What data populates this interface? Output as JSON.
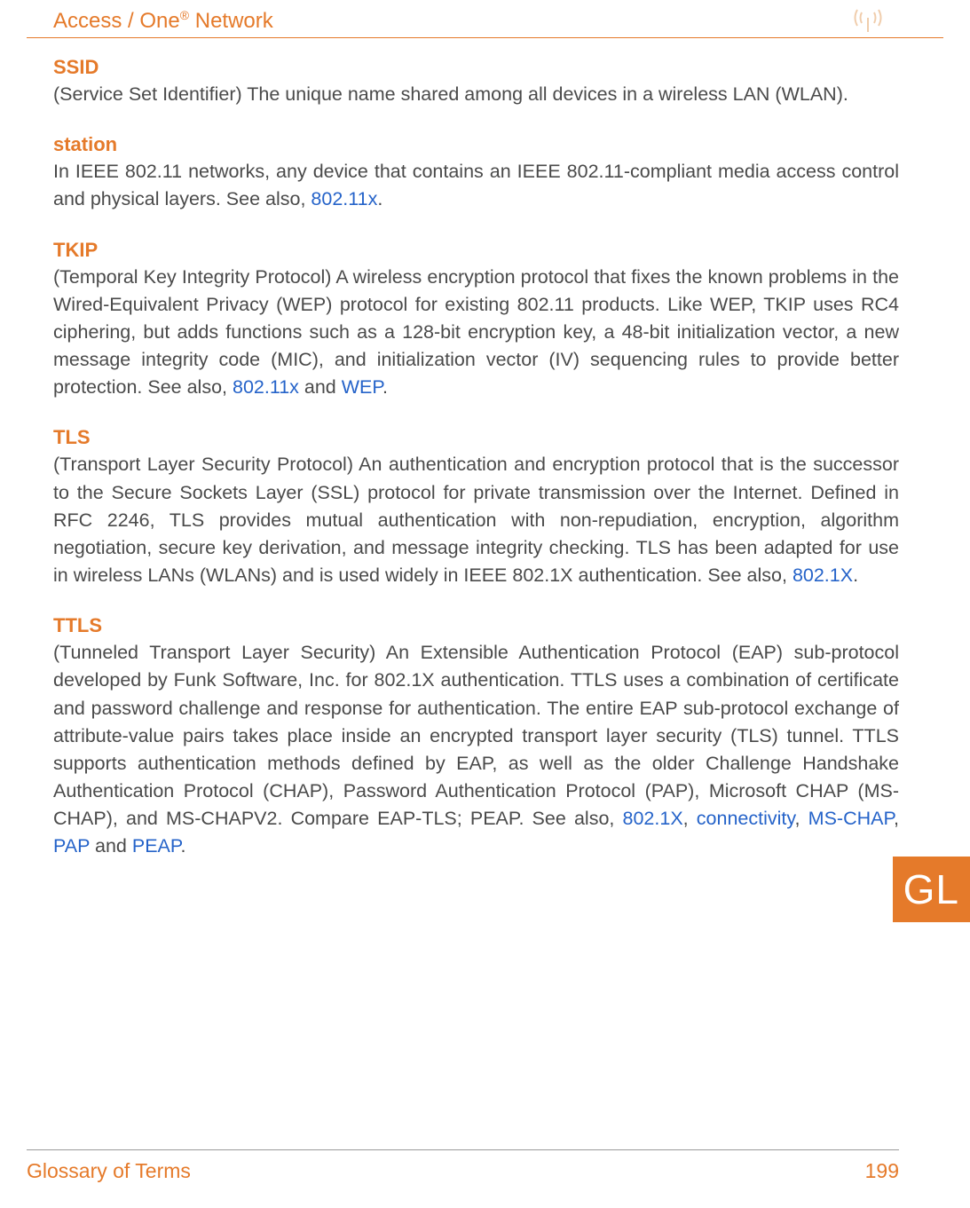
{
  "header": {
    "title_pre": "Access / One",
    "title_reg": "®",
    "title_post": " Network"
  },
  "terms": {
    "ssid": {
      "label": "SSID",
      "text_before": "(Service Set Identifier) The unique name shared among all devices in a wireless LAN (WLAN)."
    },
    "station": {
      "label": "station",
      "text_before": "In IEEE 802.11 networks, any device that contains an IEEE 802.11-compliant media access control and physical layers. See also, ",
      "link1": "802.11x",
      "text_after": "."
    },
    "tkip": {
      "label": "TKIP",
      "text_before": "(Temporal Key Integrity Protocol) A wireless encryption protocol that fixes the known problems in the Wired-Equivalent Privacy (WEP) protocol for existing 802.11 products. Like WEP, TKIP uses RC4 ciphering, but adds functions such as a 128-bit encryption key, a 48-bit initialization vector, a new message integrity code (MIC), and initialization vector (IV) sequencing rules to provide better protection. See also, ",
      "link1": "802.11x",
      "mid1": " and ",
      "link2": "WEP",
      "text_after": "."
    },
    "tls": {
      "label": "TLS",
      "text_before": "(Transport Layer Security Protocol) An authentication and encryption protocol that is the successor to the Secure Sockets Layer (SSL) protocol for private transmission over the Internet. Defined in RFC 2246, TLS provides mutual authentication with non-repudiation, encryption, algorithm negotiation, secure key derivation, and message integrity checking. TLS has been adapted for use in wireless LANs (WLANs) and is used widely in IEEE 802.1X authentication. See also, ",
      "link1": "802.1X",
      "text_after": "."
    },
    "ttls": {
      "label": "TTLS",
      "text_before": "(Tunneled Transport Layer Security) An Extensible Authentication Protocol (EAP) sub-protocol developed by Funk Software, Inc. for 802.1X authentication. TTLS uses a combination of certificate and password challenge and response for authentication. The entire EAP sub-protocol exchange of attribute-value pairs takes place inside an encrypted transport layer security (TLS) tunnel. TTLS supports authentication methods defined by EAP, as well as the older Challenge Handshake Authentication Protocol (CHAP), Password Authentication Protocol (PAP), Microsoft CHAP (MS-CHAP), and MS-CHAPV2. Compare EAP-TLS; PEAP. See also, ",
      "link1": "802.1X",
      "sep1": ", ",
      "link2": "connectivity",
      "sep2": ", ",
      "link3": "MS-CHAP",
      "sep3": ", ",
      "link4": "PAP",
      "sep4": " and ",
      "link5": "PEAP",
      "text_after": "."
    }
  },
  "sidebar": {
    "tab": "GL"
  },
  "footer": {
    "title": "Glossary of Terms",
    "page": "199"
  }
}
